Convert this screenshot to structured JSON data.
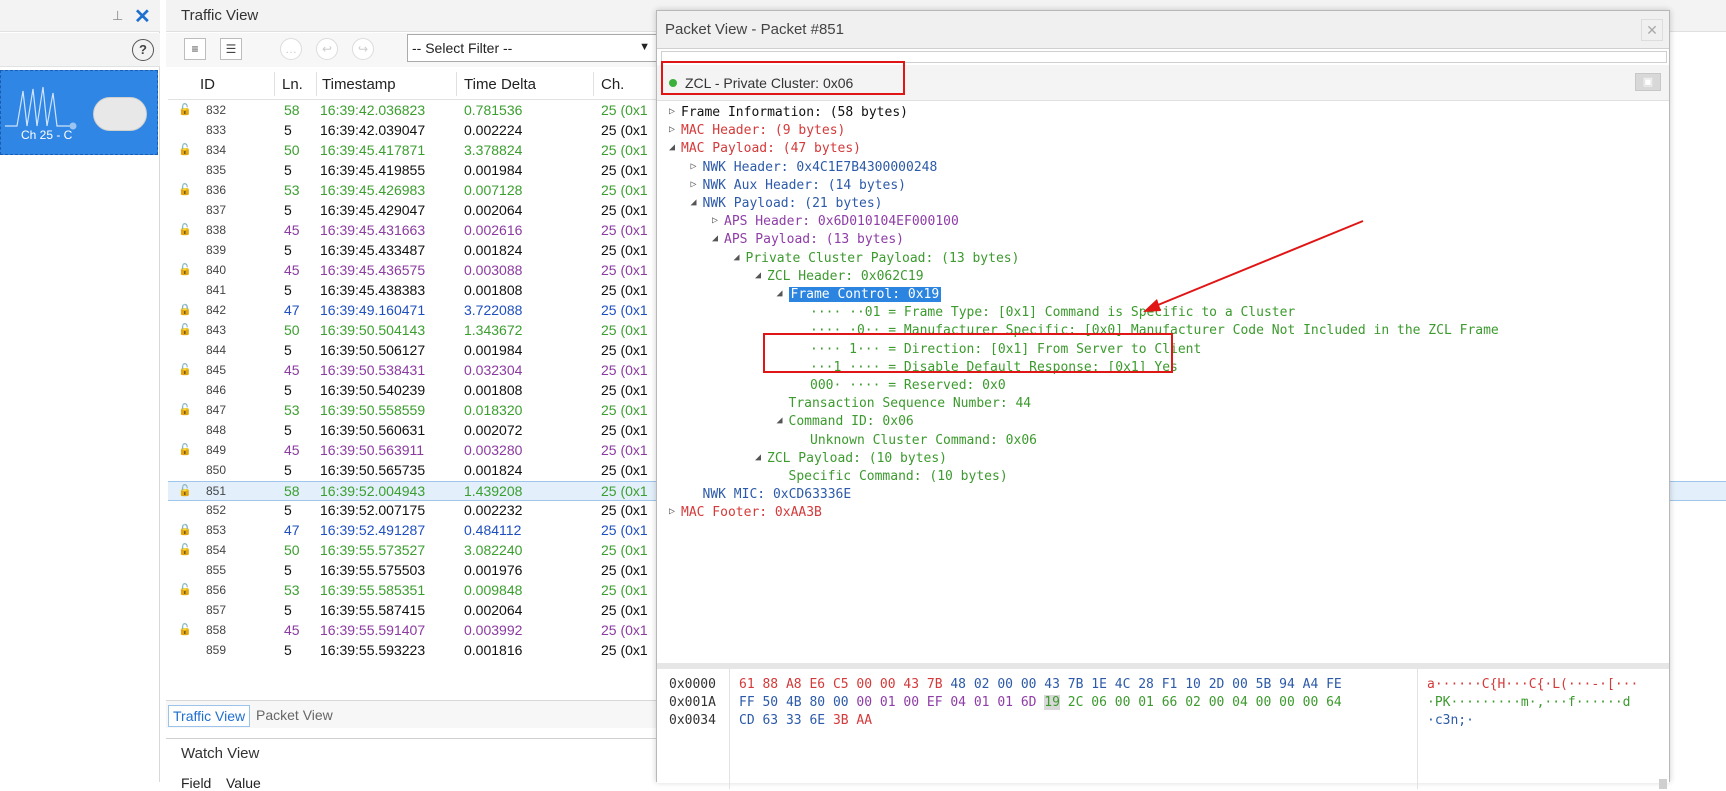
{
  "left_pane": {
    "channel_label": "Ch 25 - C",
    "help_label": "?",
    "close_label": "✕",
    "pin_label": "📌"
  },
  "traffic_view": {
    "title": "Traffic View",
    "filter_value": "-- Select Filter --",
    "columns": [
      "ID",
      "Ln.",
      "Timestamp",
      "Time Delta",
      "Ch."
    ],
    "rows": [
      {
        "id": "832",
        "ln": "58",
        "ts": "16:39:42.036823",
        "td": "0.781536",
        "ch": "25 (0x1",
        "color": "green",
        "lock": "open"
      },
      {
        "id": "833",
        "ln": "5",
        "ts": "16:39:42.039047",
        "td": "0.002224",
        "ch": "25 (0x1",
        "color": "black",
        "lock": ""
      },
      {
        "id": "834",
        "ln": "50",
        "ts": "16:39:45.417871",
        "td": "3.378824",
        "ch": "25 (0x1",
        "color": "green",
        "lock": "open"
      },
      {
        "id": "835",
        "ln": "5",
        "ts": "16:39:45.419855",
        "td": "0.001984",
        "ch": "25 (0x1",
        "color": "black",
        "lock": ""
      },
      {
        "id": "836",
        "ln": "53",
        "ts": "16:39:45.426983",
        "td": "0.007128",
        "ch": "25 (0x1",
        "color": "green",
        "lock": "open"
      },
      {
        "id": "837",
        "ln": "5",
        "ts": "16:39:45.429047",
        "td": "0.002064",
        "ch": "25 (0x1",
        "color": "black",
        "lock": ""
      },
      {
        "id": "838",
        "ln": "45",
        "ts": "16:39:45.431663",
        "td": "0.002616",
        "ch": "25 (0x1",
        "color": "purple",
        "lock": "open"
      },
      {
        "id": "839",
        "ln": "5",
        "ts": "16:39:45.433487",
        "td": "0.001824",
        "ch": "25 (0x1",
        "color": "black",
        "lock": ""
      },
      {
        "id": "840",
        "ln": "45",
        "ts": "16:39:45.436575",
        "td": "0.003088",
        "ch": "25 (0x1",
        "color": "purple",
        "lock": "open"
      },
      {
        "id": "841",
        "ln": "5",
        "ts": "16:39:45.438383",
        "td": "0.001808",
        "ch": "25 (0x1",
        "color": "black",
        "lock": ""
      },
      {
        "id": "842",
        "ln": "47",
        "ts": "16:39:49.160471",
        "td": "3.722088",
        "ch": "25 (0x1",
        "color": "blue",
        "lock": "closed"
      },
      {
        "id": "843",
        "ln": "50",
        "ts": "16:39:50.504143",
        "td": "1.343672",
        "ch": "25 (0x1",
        "color": "green",
        "lock": "open"
      },
      {
        "id": "844",
        "ln": "5",
        "ts": "16:39:50.506127",
        "td": "0.001984",
        "ch": "25 (0x1",
        "color": "black",
        "lock": ""
      },
      {
        "id": "845",
        "ln": "45",
        "ts": "16:39:50.538431",
        "td": "0.032304",
        "ch": "25 (0x1",
        "color": "purple",
        "lock": "open"
      },
      {
        "id": "846",
        "ln": "5",
        "ts": "16:39:50.540239",
        "td": "0.001808",
        "ch": "25 (0x1",
        "color": "black",
        "lock": ""
      },
      {
        "id": "847",
        "ln": "53",
        "ts": "16:39:50.558559",
        "td": "0.018320",
        "ch": "25 (0x1",
        "color": "green",
        "lock": "open"
      },
      {
        "id": "848",
        "ln": "5",
        "ts": "16:39:50.560631",
        "td": "0.002072",
        "ch": "25 (0x1",
        "color": "black",
        "lock": ""
      },
      {
        "id": "849",
        "ln": "45",
        "ts": "16:39:50.563911",
        "td": "0.003280",
        "ch": "25 (0x1",
        "color": "purple",
        "lock": "open"
      },
      {
        "id": "850",
        "ln": "5",
        "ts": "16:39:50.565735",
        "td": "0.001824",
        "ch": "25 (0x1",
        "color": "black",
        "lock": ""
      },
      {
        "id": "851",
        "ln": "58",
        "ts": "16:39:52.004943",
        "td": "1.439208",
        "ch": "25 (0x1",
        "color": "green",
        "lock": "open",
        "selected": true
      },
      {
        "id": "852",
        "ln": "5",
        "ts": "16:39:52.007175",
        "td": "0.002232",
        "ch": "25 (0x1",
        "color": "black",
        "lock": ""
      },
      {
        "id": "853",
        "ln": "47",
        "ts": "16:39:52.491287",
        "td": "0.484112",
        "ch": "25 (0x1",
        "color": "blue",
        "lock": "closed"
      },
      {
        "id": "854",
        "ln": "50",
        "ts": "16:39:55.573527",
        "td": "3.082240",
        "ch": "25 (0x1",
        "color": "green",
        "lock": "open"
      },
      {
        "id": "855",
        "ln": "5",
        "ts": "16:39:55.575503",
        "td": "0.001976",
        "ch": "25 (0x1",
        "color": "black",
        "lock": ""
      },
      {
        "id": "856",
        "ln": "53",
        "ts": "16:39:55.585351",
        "td": "0.009848",
        "ch": "25 (0x1",
        "color": "green",
        "lock": "open"
      },
      {
        "id": "857",
        "ln": "5",
        "ts": "16:39:55.587415",
        "td": "0.002064",
        "ch": "25 (0x1",
        "color": "black",
        "lock": ""
      },
      {
        "id": "858",
        "ln": "45",
        "ts": "16:39:55.591407",
        "td": "0.003992",
        "ch": "25 (0x1",
        "color": "purple",
        "lock": "open"
      },
      {
        "id": "859",
        "ln": "5",
        "ts": "16:39:55.593223",
        "td": "0.001816",
        "ch": "25 (0x1",
        "color": "black",
        "lock": ""
      }
    ],
    "tabs": [
      {
        "label": "Traffic View",
        "active": true
      },
      {
        "label": "Packet View",
        "active": false
      }
    ]
  },
  "watch_view": {
    "title": "Watch View",
    "col_field": "Field",
    "col_value": "Value"
  },
  "packet_view": {
    "title": "Packet View - Packet #851",
    "close_label": "✕",
    "summary": "ZCL - Private Cluster: 0x06",
    "tree": [
      {
        "text": "Frame Information: (58 bytes)",
        "indent": 0,
        "expander": "collapsed",
        "color": "black"
      },
      {
        "text": "MAC Header: (9 bytes)",
        "indent": 0,
        "expander": "collapsed",
        "color": "red"
      },
      {
        "text": "MAC Payload: (47 bytes)",
        "indent": 0,
        "expander": "expanded",
        "color": "red"
      },
      {
        "text": "NWK Header: 0x4C1E7B4300000248",
        "indent": 1,
        "expander": "collapsed",
        "color": "blue"
      },
      {
        "text": "NWK Aux Header: (14 bytes)",
        "indent": 1,
        "expander": "collapsed",
        "color": "blue"
      },
      {
        "text": "NWK Payload: (21 bytes)",
        "indent": 1,
        "expander": "expanded",
        "color": "blue"
      },
      {
        "text": "APS Header: 0x6D010104EF000100",
        "indent": 2,
        "expander": "collapsed",
        "color": "purple"
      },
      {
        "text": "APS Payload: (13 bytes)",
        "indent": 2,
        "expander": "expanded",
        "color": "purple"
      },
      {
        "text": "Private Cluster Payload: (13 bytes)",
        "indent": 3,
        "expander": "expanded",
        "color": "green"
      },
      {
        "text": "ZCL Header: 0x062C19",
        "indent": 4,
        "expander": "expanded",
        "color": "green"
      },
      {
        "text": "Frame Control: 0x19",
        "indent": 5,
        "expander": "expanded",
        "color": "green",
        "highlight": true
      },
      {
        "text": "···· ··01 = Frame Type: [0x1] Command is Specific to a Cluster",
        "indent": 6,
        "expander": "",
        "color": "green"
      },
      {
        "text": "···· ·0·· = Manufacturer Specific: [0x0] Manufacturer Code Not Included in the ZCL Frame",
        "indent": 6,
        "expander": "",
        "color": "green"
      },
      {
        "text": "···· 1··· = Direction: [0x1] From Server to Client",
        "indent": 6,
        "expander": "",
        "color": "green"
      },
      {
        "text": "···1 ···· = Disable Default Response: [0x1] Yes",
        "indent": 6,
        "expander": "",
        "color": "green"
      },
      {
        "text": "000· ···· = Reserved: 0x0",
        "indent": 6,
        "expander": "",
        "color": "green"
      },
      {
        "text": "Transaction Sequence Number: 44",
        "indent": 5,
        "expander": "",
        "color": "green"
      },
      {
        "text": "Command ID: 0x06",
        "indent": 5,
        "expander": "expanded",
        "color": "green"
      },
      {
        "text": "Unknown Cluster Command: 0x06",
        "indent": 6,
        "expander": "",
        "color": "green"
      },
      {
        "text": "ZCL Payload: (10 bytes)",
        "indent": 4,
        "expander": "expanded",
        "color": "green"
      },
      {
        "text": "Specific Command: (10 bytes)",
        "indent": 5,
        "expander": "",
        "color": "green"
      },
      {
        "text": "NWK MIC: 0xCD63336E",
        "indent": 1,
        "expander": "",
        "color": "blue"
      },
      {
        "text": "MAC Footer: 0xAA3B",
        "indent": 0,
        "expander": "collapsed",
        "color": "red"
      }
    ],
    "hex": [
      {
        "offset": "0x0000",
        "bytes": "61 88 A8 E6 C5 00 00 43 7B 48 02 00 00 43 7B 1E 4C 28 F1 10 2D 00 5B 94 A4 FE",
        "ascii": "a······C{H···C{·L(···-·[···"
      },
      {
        "offset": "0x001A",
        "bytes": "FF 50 4B 80 00 00 01 00 EF 04 01 01 6D 19 2C 06 00 01 66 02 00 04 00 00 00 64",
        "ascii": "·PK·········m·,···f······d"
      },
      {
        "offset": "0x0034",
        "bytes": "CD 63 33 6E 3B AA",
        "ascii": "·c3n;·"
      }
    ]
  }
}
